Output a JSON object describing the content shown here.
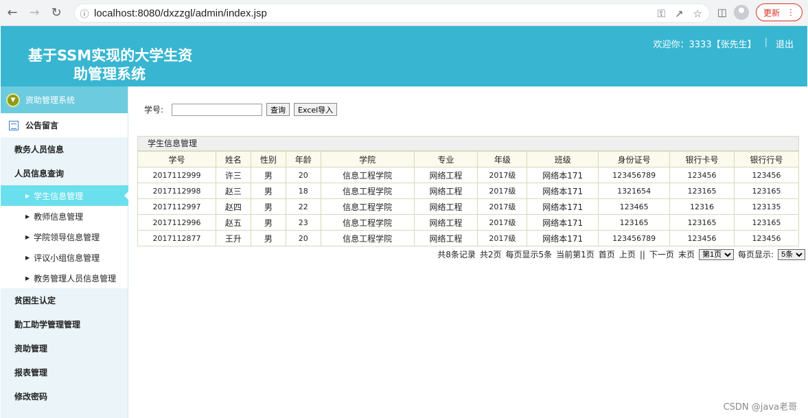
{
  "browser": {
    "url": "localhost:8080/dxzzgl/admin/index.jsp",
    "update_label": "更新"
  },
  "header": {
    "title_line1": "基于SSM实现的大学生资",
    "title_line2": "助管理系统",
    "welcome": "欢迎你：3333【张先生】",
    "separator": "|",
    "logout": "退出"
  },
  "sidebar": {
    "head": "资助管理系统",
    "items_top": [
      "公告留言",
      "教务人员信息",
      "人员信息查询"
    ],
    "sub_items": [
      "学生信息管理",
      "教师信息管理",
      "学院领导信息管理",
      "评议小组信息管理",
      "教务管理人员信息管理"
    ],
    "items_bottom": [
      "贫困生认定",
      "勤工助学管理管理",
      "资助管理",
      "报表管理",
      "修改密码"
    ]
  },
  "search": {
    "label": "学号:",
    "value": "",
    "query_btn": "查询",
    "excel_btn": "Excel导入"
  },
  "table": {
    "title": "学生信息管理",
    "columns": [
      "学号",
      "姓名",
      "性别",
      "年龄",
      "学院",
      "专业",
      "年级",
      "班级",
      "身份证号",
      "银行卡号",
      "银行行号"
    ],
    "rows": [
      [
        "2017112999",
        "许三",
        "男",
        "20",
        "信息工程学院",
        "网络工程",
        "2017级",
        "网络本171",
        "123456789",
        "123456",
        "123456"
      ],
      [
        "2017112998",
        "赵三",
        "男",
        "18",
        "信息工程学院",
        "网络工程",
        "2017级",
        "网络本171",
        "1321654",
        "123165",
        "123165"
      ],
      [
        "2017112997",
        "赵四",
        "男",
        "22",
        "信息工程学院",
        "网络工程",
        "2017级",
        "网络本171",
        "123465",
        "12316",
        "123135"
      ],
      [
        "2017112996",
        "赵五",
        "男",
        "23",
        "信息工程学院",
        "网络工程",
        "2017级",
        "网络本171",
        "123165",
        "123165",
        "123165"
      ],
      [
        "2017112877",
        "王升",
        "男",
        "20",
        "信息工程学院",
        "网络工程",
        "2017级",
        "网络本171",
        "123456789",
        "123456",
        "123456"
      ]
    ]
  },
  "pager": {
    "total": "共8条记录",
    "pages": "共2页",
    "per_page": "每页显示5条",
    "current": "当前第1页",
    "first": "首页",
    "prev": "上页",
    "sep": "||",
    "next": "下一页",
    "last": "末页",
    "page_select": "第1页",
    "per_label": "每页显示:",
    "per_select": "5条"
  },
  "watermark": "CSDN @java老哥"
}
